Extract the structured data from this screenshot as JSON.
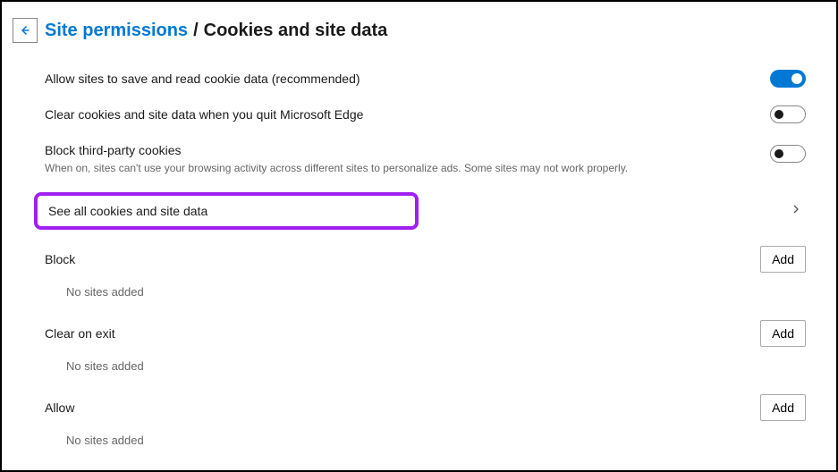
{
  "header": {
    "breadcrumb_parent": "Site permissions",
    "separator": "/",
    "breadcrumb_current": "Cookies and site data"
  },
  "settings": {
    "allow_cookies": {
      "label": "Allow sites to save and read cookie data (recommended)",
      "on": true
    },
    "clear_on_quit": {
      "label": "Clear cookies and site data when you quit Microsoft Edge",
      "on": false
    },
    "block_third_party": {
      "label": "Block third-party cookies",
      "sub": "When on, sites can't use your browsing activity across different sites to personalize ads. Some sites may not work properly.",
      "on": false
    },
    "see_all": {
      "label": "See all cookies and site data"
    }
  },
  "sections": {
    "block": {
      "title": "Block",
      "add": "Add",
      "empty": "No sites added"
    },
    "clear_exit": {
      "title": "Clear on exit",
      "add": "Add",
      "empty": "No sites added"
    },
    "allow": {
      "title": "Allow",
      "add": "Add",
      "empty": "No sites added"
    }
  }
}
